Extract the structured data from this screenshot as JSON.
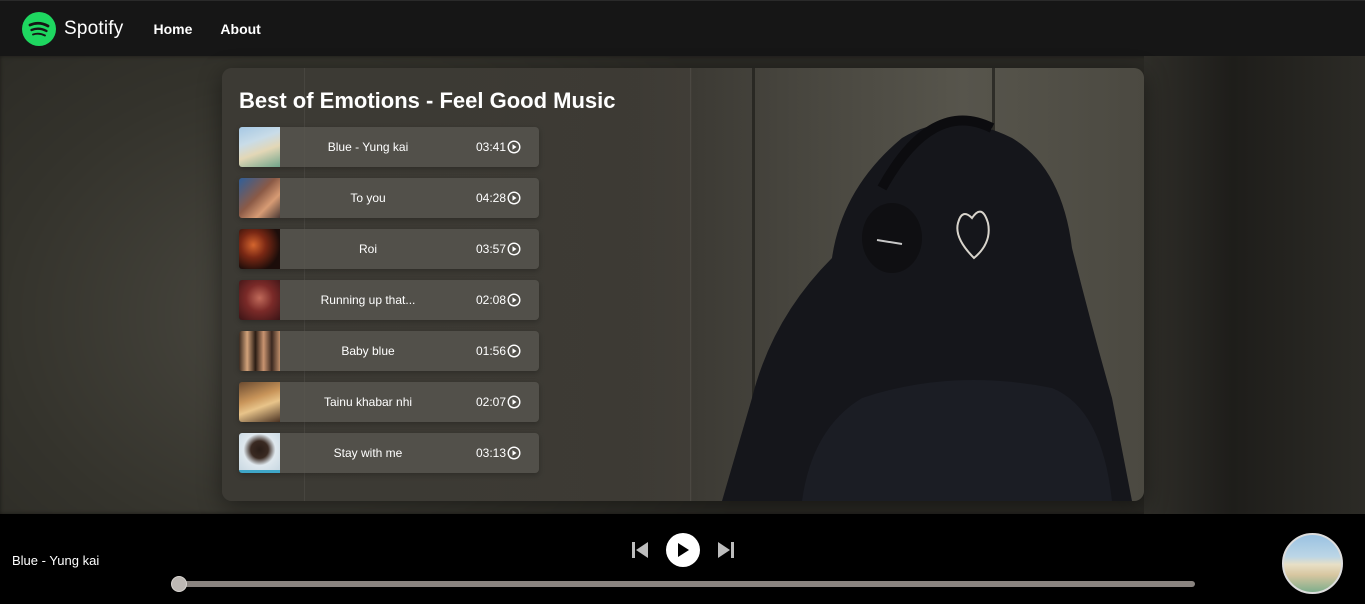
{
  "navbar": {
    "brand": "Spotify",
    "links": [
      "Home",
      "About"
    ],
    "logo_icon": "spotify-logo-icon",
    "accent": "#1ed760"
  },
  "playlist": {
    "title": "Best of Emotions - Feel Good Music",
    "songs": [
      {
        "name": "Blue - Yung kai",
        "duration": "03:41",
        "thumb_colors": [
          "#8fb7d8",
          "#e1d6b4"
        ]
      },
      {
        "name": "To you",
        "duration": "04:28",
        "thumb_colors": [
          "#3b6ea8",
          "#c27a56"
        ]
      },
      {
        "name": "Roi",
        "duration": "03:57",
        "thumb_colors": [
          "#2a1410",
          "#c4431e"
        ]
      },
      {
        "name": "Running up that...",
        "duration": "02:08",
        "thumb_colors": [
          "#4a1c1c",
          "#b54a3e"
        ]
      },
      {
        "name": "Baby blue",
        "duration": "01:56",
        "thumb_colors": [
          "#2c1f18",
          "#d09a6c"
        ]
      },
      {
        "name": "Tainu khabar nhi",
        "duration": "02:07",
        "thumb_colors": [
          "#5a3c26",
          "#e2b46a"
        ]
      },
      {
        "name": "Stay with me",
        "duration": "03:13",
        "thumb_colors": [
          "#d8e6ef",
          "#2a2018"
        ]
      }
    ]
  },
  "player": {
    "now_playing": "Blue - Yung kai",
    "progress": 0,
    "icons": {
      "prev": "skip-previous-icon",
      "play": "play-icon",
      "next": "skip-next-icon"
    }
  }
}
